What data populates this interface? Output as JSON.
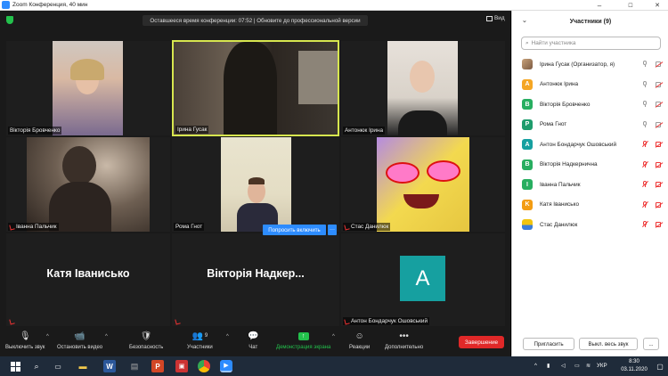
{
  "window": {
    "title": "Zoom Конференция, 40 мин",
    "minimize": "–",
    "maximize": "☐",
    "close": "✕"
  },
  "meeting": {
    "time_notice": "Оставшееся время конференции: 07:52 | Обновите до профессиональной версии",
    "view_label": "Вид",
    "ask_to_start_video": "Попросить включить",
    "more": "···",
    "tiles": [
      {
        "name": "Вікторія Бровченко",
        "muted": false
      },
      {
        "name": "Ірина Гусак",
        "muted": false
      },
      {
        "name": "Антонюк Ірина",
        "muted": false
      },
      {
        "name": "Іванна Пальчик",
        "muted": true
      },
      {
        "name": "Рома Гнот",
        "muted": false
      },
      {
        "name": "Стас Данилюк",
        "muted": true
      },
      {
        "name": "",
        "big": "Катя Іванисько",
        "muted": true
      },
      {
        "name": "",
        "big": "Вікторія Надкер...",
        "muted": true
      },
      {
        "name": "Антон Бондарчук Ошовський",
        "muted": true,
        "avatar_letter": "A"
      }
    ]
  },
  "toolbar": {
    "mute": "Выключить звук",
    "stop_video": "Остановить видео",
    "security": "Безопасность",
    "participants": "Участники",
    "participants_count": "9",
    "chat": "Чат",
    "share_screen": "Демонстрация экрана",
    "reactions": "Реакции",
    "more": "Дополнительно",
    "end": "Завершение",
    "accent": "#23c14c",
    "end_color": "#e02828"
  },
  "panel": {
    "title": "Участники  (9)",
    "search_placeholder": "Найти участника",
    "participants": [
      {
        "name": "Ірина Гусак (Организатор, я)",
        "avatar": "",
        "color": "#c8a27a",
        "photo": true,
        "mic_muted": false,
        "cam_off": false
      },
      {
        "name": "Антонюк Ірина",
        "avatar": "A",
        "color": "#f5a623",
        "mic_muted": false,
        "cam_off": false
      },
      {
        "name": "Вікторія Бровченко",
        "avatar": "B",
        "color": "#27ae60",
        "mic_muted": false,
        "cam_off": false
      },
      {
        "name": "Рома Гнот",
        "avatar": "P",
        "color": "#1e9c6c",
        "mic_muted": false,
        "cam_off": false
      },
      {
        "name": "Антон Бондарчук Ошовський",
        "avatar": "A",
        "color": "#16a0a0",
        "mic_muted": true,
        "cam_off": true
      },
      {
        "name": "Вікторія Надкернична",
        "avatar": "B",
        "color": "#27ae60",
        "mic_muted": true,
        "cam_off": true
      },
      {
        "name": "Іванна Пальчик",
        "avatar": "I",
        "color": "#27ae60",
        "mic_muted": true,
        "cam_off": true
      },
      {
        "name": "Катя Іванисько",
        "avatar": "K",
        "color": "#f39c12",
        "mic_muted": true,
        "cam_off": true
      },
      {
        "name": "Стас Данилюк",
        "avatar": "",
        "color": "#f1c40f",
        "photo": true,
        "mic_muted": true,
        "cam_off": true
      }
    ],
    "invite": "Пригласить",
    "mute_all": "Выкл. весь звук",
    "more": "..."
  },
  "taskbar": {
    "language": "УКР",
    "time": "8:30",
    "date": "03.11.2020"
  }
}
